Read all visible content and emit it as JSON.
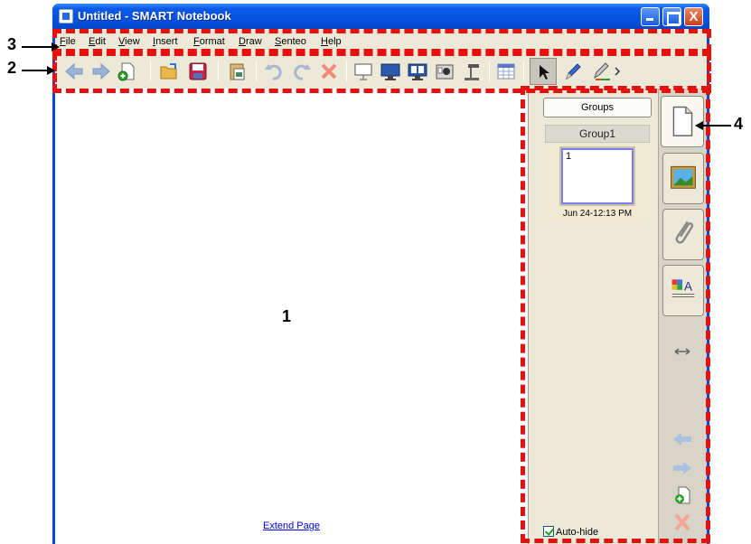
{
  "window": {
    "title": "Untitled - SMART Notebook",
    "close_glyph": "X"
  },
  "menu": [
    "File",
    "Edit",
    "View",
    "Insert",
    "Format",
    "Draw",
    "Senteo",
    "Help"
  ],
  "toolbar": {
    "icons": [
      "back-arrow-icon",
      "forward-arrow-icon",
      "add-page-icon",
      "open-folder-icon",
      "save-icon",
      "paste-icon",
      "undo-icon",
      "redo-icon",
      "delete-icon",
      "screen-shade-icon",
      "full-screen-icon",
      "dual-page-icon",
      "screen-capture-icon",
      "document-camera-icon",
      "table-icon",
      "select-pointer-icon",
      "pen-icon",
      "creative-pen-icon"
    ]
  },
  "canvas": {
    "extend_link": "Extend Page"
  },
  "page_sorter": {
    "groups_button": "Groups",
    "group_name": "Group1",
    "page_number": "1",
    "page_timestamp": "Jun 24-12:13 PM",
    "autohide_label": "Auto-hide",
    "autohide_checked": true
  },
  "side_tabs": [
    "page-sorter-tab",
    "gallery-tab",
    "attachments-tab",
    "properties-tab"
  ],
  "callouts": {
    "c1": "1",
    "c2": "2",
    "c3": "3",
    "c4": "4"
  },
  "colors": {
    "highlight": "#e5110f",
    "title_blue": "#0550dc",
    "chrome": "#ece9d8"
  }
}
